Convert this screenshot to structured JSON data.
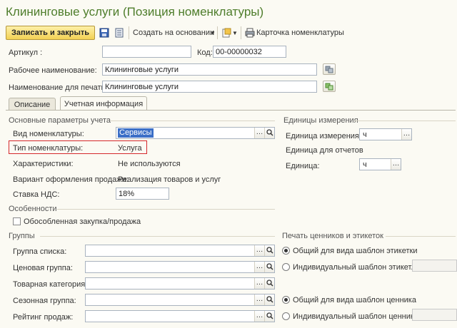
{
  "window": {
    "title": "Клининговые услуги (Позиция номенклатуры)"
  },
  "toolbar": {
    "save_close": "Записать и закрыть",
    "create_based": "Создать на основании",
    "print_card": "Карточка номенклатуры"
  },
  "header": {
    "article_label": "Артикул :",
    "article_value": "",
    "code_label": "Код:",
    "code_value": "00-00000032",
    "work_name_label": "Рабочее наименование:",
    "work_name_value": "Клининговые услуги",
    "print_name_label": "Наименование для печати:",
    "print_name_value": "Клининговые услуги"
  },
  "tabs": [
    {
      "label": "Описание"
    },
    {
      "label": "Учетная информация"
    }
  ],
  "basic": {
    "section": "Основные параметры учета",
    "kind_label": "Вид номенклатуры:",
    "kind_value": "Сервисы",
    "type_label": "Тип номенклатуры:",
    "type_value": "Услуга",
    "char_label": "Характеристики:",
    "char_value": "Не используются",
    "sale_variant_label": "Вариант оформления продажи:",
    "sale_variant_value": "Реализация товаров и услуг",
    "vat_label": "Ставка НДС:",
    "vat_value": "18%"
  },
  "units": {
    "section": "Единицы измерения",
    "unit_label": "Единица измерения:",
    "unit_value": "ч",
    "reports_label": "Единица для отчетов",
    "reports_unit_label": "Единица:",
    "reports_unit_value": "ч"
  },
  "features": {
    "section": "Особенности",
    "separate_label": "Обособленная закупка/продажа",
    "separate_checked": false
  },
  "groups": {
    "section": "Группы",
    "list_group_label": "Группа списка:",
    "list_group_value": "",
    "price_group_label": "Ценовая группа:",
    "price_group_value": "",
    "product_category_label": "Товарная категория:",
    "product_category_value": "",
    "season_group_label": "Сезонная группа:",
    "season_group_value": "",
    "sales_rating_label": "Рейтинг продаж:",
    "sales_rating_value": ""
  },
  "printing": {
    "section": "Печать ценников и этикеток",
    "label_common": "Общий для вида шаблон этикетки",
    "label_individual": "Индивидуальный шаблон этикет...",
    "price_common": "Общий для вида шаблон ценника",
    "price_individual": "Индивидуальный шаблон ценника"
  },
  "colors": {
    "title_green": "#4e7d2b",
    "accent_yellow": "#f3d154",
    "selection_blue": "#3b6fc7",
    "highlight_red": "#d5282b"
  },
  "icons": [
    "save-icon",
    "post-icon",
    "create-based-dropdown-icon",
    "create-doc-icon",
    "printer-icon",
    "copy-icon",
    "magnifier-icon",
    "dots-icon"
  ]
}
